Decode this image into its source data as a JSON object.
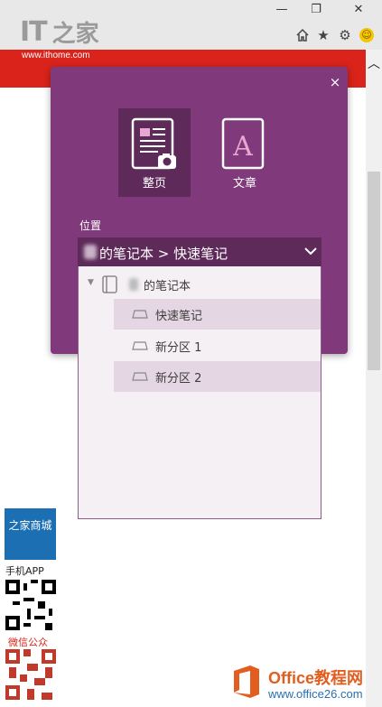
{
  "browser": {
    "logo_it": "IT",
    "logo_zh": "之家",
    "site_url": "www.ithome.com",
    "window_buttons": {
      "minimize": "—",
      "maximize": "❐",
      "close": "✕"
    },
    "toolbar_icons": [
      "home-icon",
      "star-icon",
      "gear-icon",
      "smiley-icon"
    ]
  },
  "clipper": {
    "close_label": "×",
    "modes": [
      {
        "label": "整页",
        "icon": "fullpage-icon",
        "selected": true
      },
      {
        "label": "文章",
        "icon": "article-icon",
        "selected": false
      }
    ],
    "location_label": "位置",
    "selected_location": "的笔记本 > 快速笔记",
    "notebook": {
      "name": "的笔记本",
      "expanded": true
    },
    "sections": [
      {
        "name": "快速笔记",
        "highlighted": true
      },
      {
        "name": "新分区 1",
        "highlighted": false
      },
      {
        "name": "新分区 2",
        "highlighted": true
      }
    ],
    "accent_color": "#80397b",
    "dark_accent_color": "#5e2a5a"
  },
  "side_ads": {
    "shop_label": "之家商城",
    "app_label": "手机APP",
    "wechat_label": "微信公众"
  },
  "watermark": {
    "title": "Office教程网",
    "url": "www.office26.com"
  }
}
